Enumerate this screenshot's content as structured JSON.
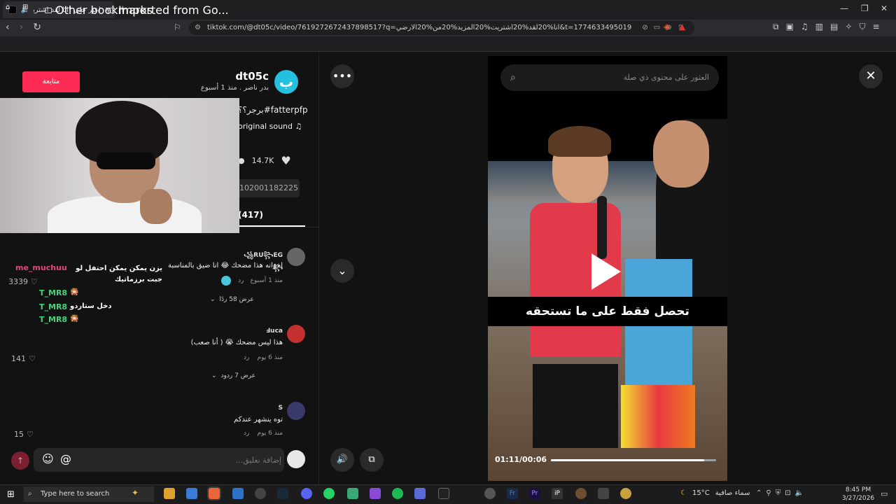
{
  "browser": {
    "tab_title": "اعثر على \"انا لقد اشتريت المزيد",
    "url": "tiktok.com/@dt05c/video/7619272672437898517?q=انا%20لقد%20اشتريت%20المزيد%20من%20الارضي&t=1774633495019",
    "bookmarks": [
      "Other bookmarks",
      "Imported from Go..."
    ]
  },
  "post": {
    "follow_label": "متابعة",
    "avatar_letter": "ب",
    "username": "dt05c",
    "meta": "بدر ناصر . منذ 1 أسبوع",
    "caption": "برجر؟؟#fatterpfp",
    "sound": "original sound ♫",
    "likes": "14.7K",
    "link_text": "102001182225",
    "comments_tab": "(417)"
  },
  "live_chat": [
    {
      "name": "me_muchuu",
      "text": "يزن يمكن يمكن احتفل لو جبت برزماتيك"
    },
    {
      "name": "T_MR8",
      "text": "🎇"
    },
    {
      "name": "T_MR8",
      "text": "دخل ستاردو"
    },
    {
      "name": "T_MR8",
      "text": "🎇"
    }
  ],
  "comments": [
    {
      "name": "꧁RU꧂EG꧂",
      "text": "إخوانه هذا مضحك 😂 انا ضيق بالمناسبة",
      "time": "منذ 1 أسبوع",
      "reply": "رد",
      "likes": "3339",
      "more": "عرض 58 ردًا"
    },
    {
      "name": "Ⅎuca",
      "text": "هذا ليس مضحك 😭 ( أنا صعب)",
      "time": "منذ 6 يوم",
      "reply": "رد",
      "likes": "141",
      "more": "عرض 7 ردود"
    },
    {
      "name": "S",
      "text": "توه ينشهر عندكم",
      "time": "منذ 6 يوم",
      "reply": "رد",
      "likes": "15",
      "more": ""
    }
  ],
  "comment_input": {
    "placeholder": "إضافة تعليق..."
  },
  "video": {
    "search_placeholder": "العثور على محتوى ذي صلة",
    "subtitle": "تحصل فقط على ما تستحقه",
    "time": "01:11/00:06",
    "progress": 0.93
  },
  "taskbar": {
    "search_placeholder": "Type here to search",
    "weather_temp": "15°C",
    "weather_text": "سماء صافية",
    "time": "8:45 PM",
    "date": "3/27/2026"
  },
  "colors": {
    "accent": "#fe2c55",
    "chat_name": "#e0497a",
    "chat_name2": "#46d37a"
  }
}
